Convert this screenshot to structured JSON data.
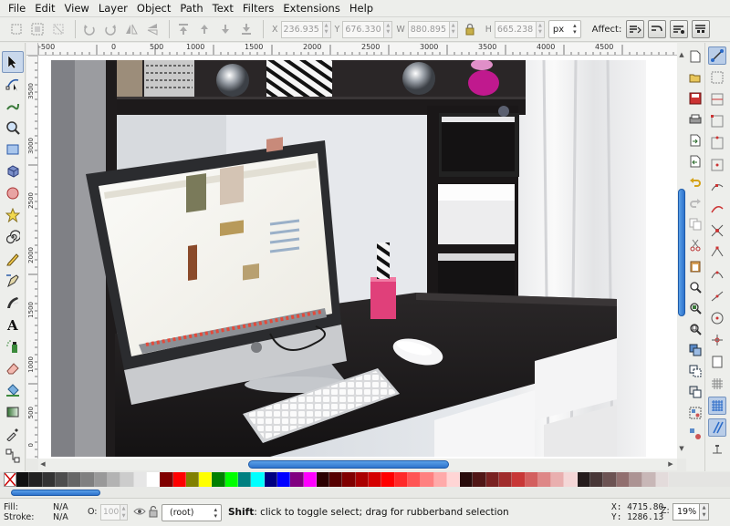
{
  "menu": [
    "File",
    "Edit",
    "View",
    "Layer",
    "Object",
    "Path",
    "Text",
    "Filters",
    "Extensions",
    "Help"
  ],
  "toolbar": {
    "x_label": "X",
    "x_value": "236.935",
    "y_label": "Y",
    "y_value": "676.330",
    "w_label": "W",
    "w_value": "880.895",
    "h_label": "H",
    "h_value": "665.238",
    "unit": "px",
    "affect_label": "Affect:"
  },
  "ruler": {
    "h_ticks": [
      "-500",
      "0",
      "500",
      "1000",
      "1500",
      "2000",
      "2500",
      "3000",
      "3500",
      "4000",
      "4500"
    ],
    "v_ticks": [
      "3500",
      "3000",
      "2500",
      "2000",
      "1500",
      "1000",
      "500",
      "0"
    ]
  },
  "palette": {
    "colors": [
      "#111111",
      "#222222",
      "#333333",
      "#4d4d4d",
      "#666666",
      "#808080",
      "#999999",
      "#b3b3b3",
      "#cccccc",
      "#e6e6e6",
      "#ffffff",
      "#800000",
      "#ff0000",
      "#808000",
      "#ffff00",
      "#008000",
      "#00ff00",
      "#008080",
      "#00ffff",
      "#000080",
      "#0000ff",
      "#800080",
      "#ff00ff",
      "#2b0000",
      "#550000",
      "#800000",
      "#aa0000",
      "#d40000",
      "#ff0000",
      "#ff2a2a",
      "#ff5555",
      "#ff8080",
      "#ffaaaa",
      "#ffd5d5",
      "#280b0b",
      "#501616",
      "#782121",
      "#a02c2c",
      "#c83737",
      "#d35f5f",
      "#de8787",
      "#e9afaf",
      "#f4d7d7",
      "#241c1c",
      "#483737",
      "#6c5353",
      "#916f6f",
      "#ac9393",
      "#c8b7b7",
      "#e3dbdb"
    ]
  },
  "status": {
    "fill_label": "Fill:",
    "fill_value": "N/A",
    "stroke_label": "Stroke:",
    "stroke_value": "N/A",
    "opacity_label": "O:",
    "opacity_value": "100",
    "layer": "(root)",
    "message_bold": "Shift",
    "message_rest": ": click to toggle select; drag for rubberband selection",
    "x_coord": "X: 4715.80",
    "y_coord": "Y: 1286.13",
    "zoom_label": "Z:",
    "zoom_value": "19%"
  }
}
